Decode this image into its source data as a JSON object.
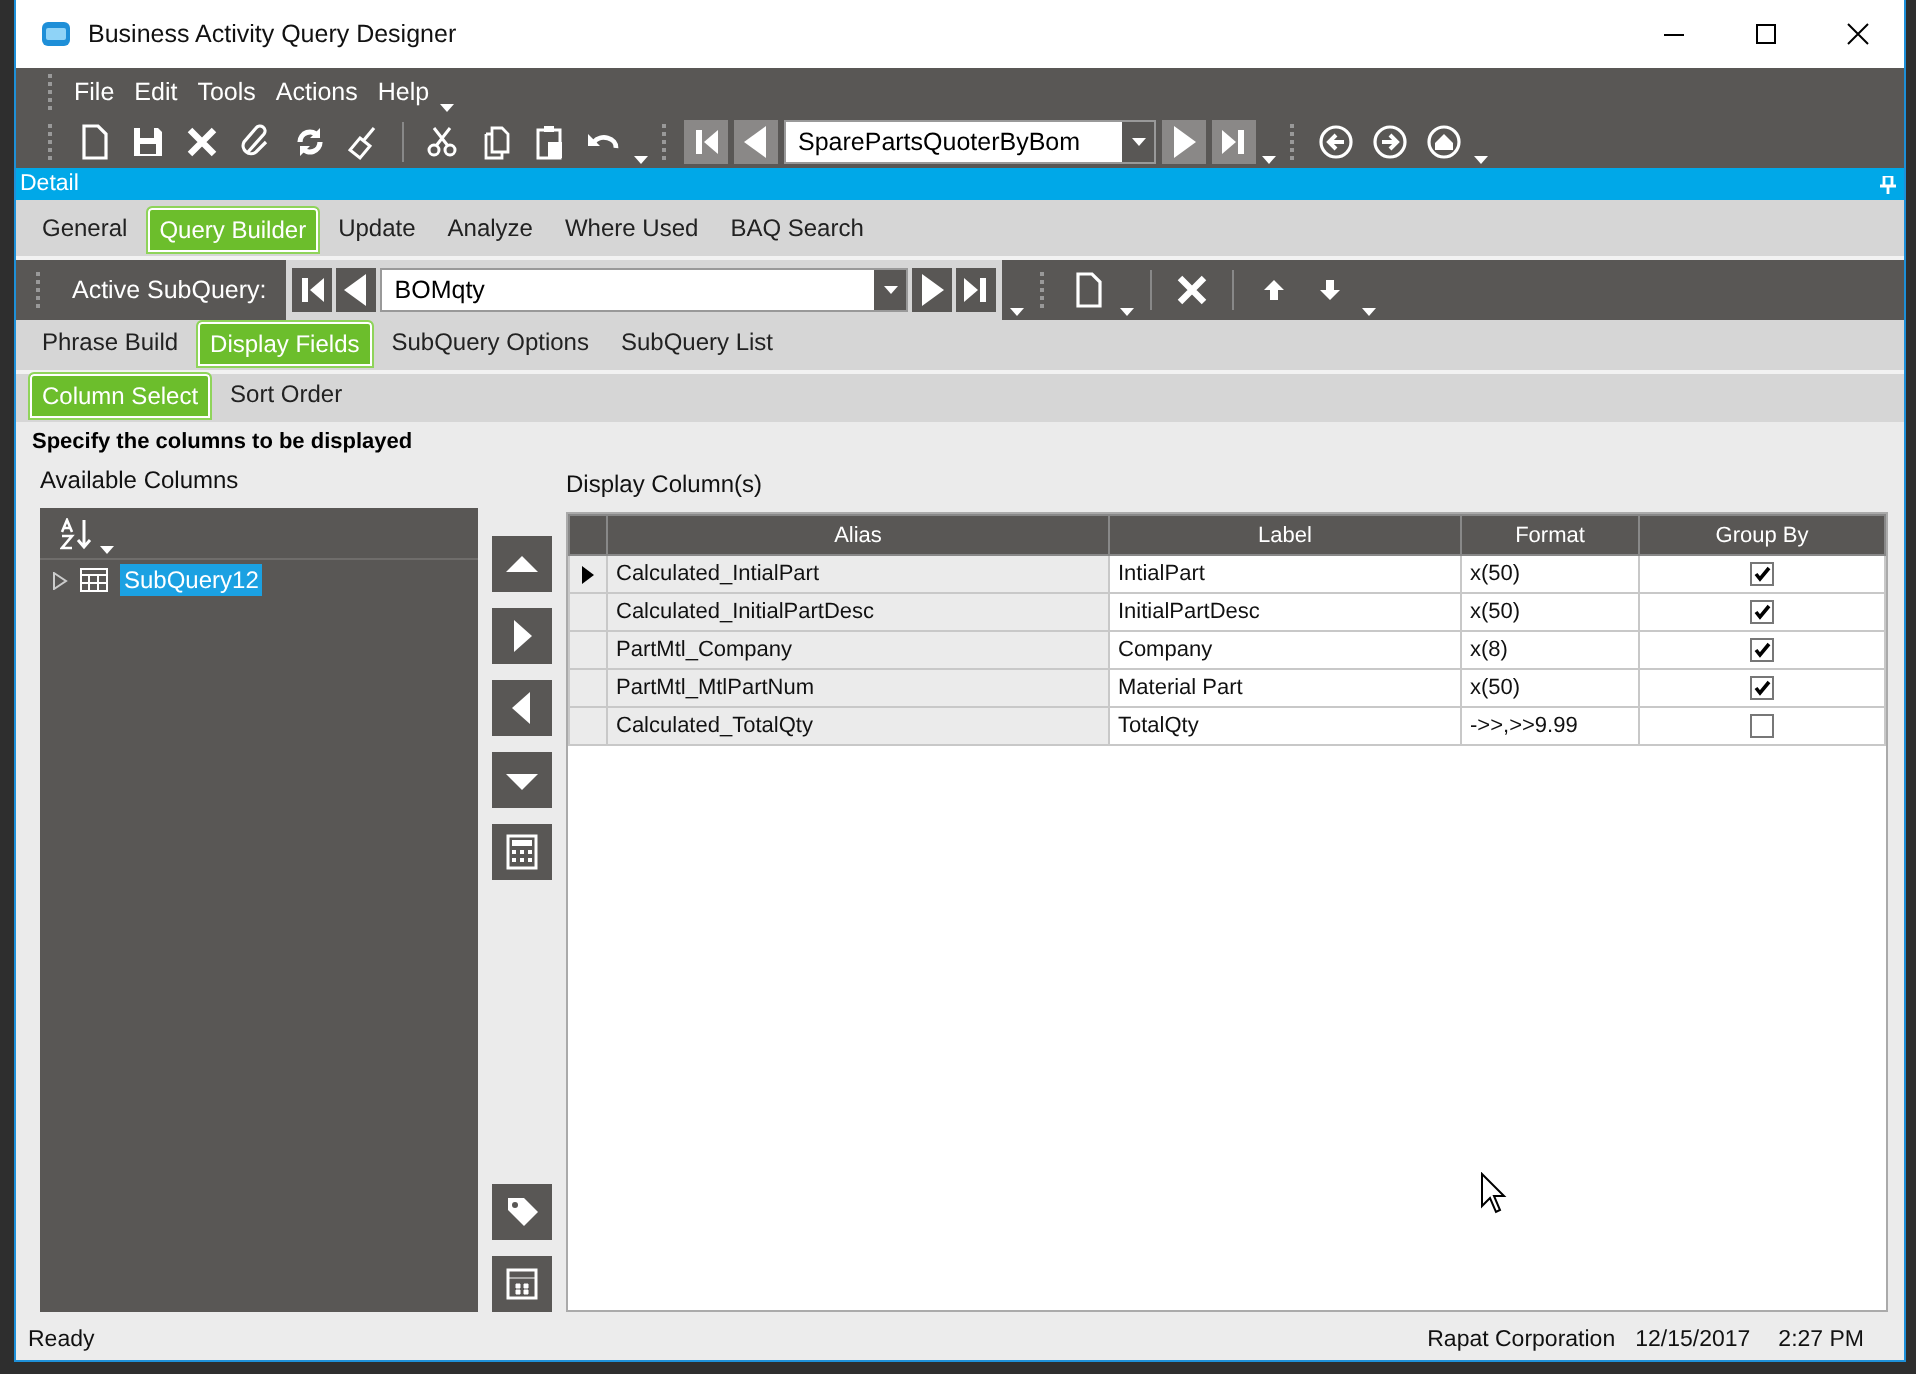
{
  "window": {
    "title": "Business Activity Query Designer"
  },
  "menu": [
    "File",
    "Edit",
    "Tools",
    "Actions",
    "Help"
  ],
  "toolbar": {
    "query_combo": {
      "value": "SparePartsQuoterByBom"
    }
  },
  "panel": {
    "title": "Detail"
  },
  "tabs": [
    {
      "label": "General",
      "selected": false
    },
    {
      "label": "Query Builder",
      "selected": true
    },
    {
      "label": "Update",
      "selected": false
    },
    {
      "label": "Analyze",
      "selected": false
    },
    {
      "label": "Where Used",
      "selected": false
    },
    {
      "label": "BAQ Search",
      "selected": false
    }
  ],
  "subquery_bar": {
    "label": "Active SubQuery:",
    "value": "BOMqty"
  },
  "subtabs": [
    {
      "label": "Phrase Build",
      "selected": false
    },
    {
      "label": "Display Fields",
      "selected": true
    },
    {
      "label": "SubQuery Options",
      "selected": false
    },
    {
      "label": "SubQuery List",
      "selected": false
    }
  ],
  "inner_tabs": [
    {
      "label": "Column Select",
      "selected": true
    },
    {
      "label": "Sort Order",
      "selected": false
    }
  ],
  "instruction": "Specify the columns to be displayed",
  "available": {
    "title": "Available Columns",
    "tree": [
      {
        "label": "SubQuery12",
        "expanded": false,
        "selected": true
      }
    ]
  },
  "display": {
    "title": "Display Column(s)",
    "table": {
      "columns": [
        "Alias",
        "Label",
        "Format",
        "Group By"
      ],
      "rows": [
        {
          "alias": "Calculated_IntialPart",
          "label": "IntialPart",
          "format": "x(50)",
          "group_by": true,
          "current": true
        },
        {
          "alias": "Calculated_InitialPartDesc",
          "label": "InitialPartDesc",
          "format": "x(50)",
          "group_by": true,
          "current": false
        },
        {
          "alias": "PartMtl_Company",
          "label": "Company",
          "format": "x(8)",
          "group_by": true,
          "current": false
        },
        {
          "alias": "PartMtl_MtlPartNum",
          "label": "Material Part",
          "format": "x(50)",
          "group_by": true,
          "current": false
        },
        {
          "alias": "Calculated_TotalQty",
          "label": "TotalQty",
          "format": "->>,>>9.99",
          "group_by": false,
          "current": false
        }
      ]
    }
  },
  "status_bar": {
    "status": "Ready",
    "company": "Rapat Corporation",
    "date": "12/15/2017",
    "time": "2:27 PM"
  }
}
